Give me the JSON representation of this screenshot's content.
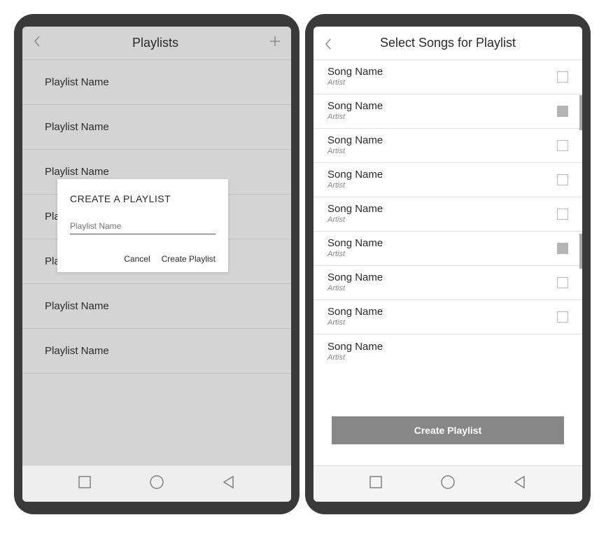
{
  "phone1": {
    "title": "Playlists",
    "playlists": [
      {
        "name": "Playlist Name"
      },
      {
        "name": "Playlist Name"
      },
      {
        "name": "Playlist Name"
      },
      {
        "name": "Playlist Name"
      },
      {
        "name": "Playlist Name"
      },
      {
        "name": "Playlist Name"
      },
      {
        "name": "Playlist Name"
      }
    ],
    "modal": {
      "title": "CREATE A  PLAYLIST",
      "placeholder": "Playlist Name",
      "cancel": "Cancel",
      "create": "Create Playlist"
    }
  },
  "phone2": {
    "title": "Select Songs for Playlist",
    "songs": [
      {
        "name": "Song Name",
        "artist": "Artist",
        "checked": false
      },
      {
        "name": "Song Name",
        "artist": "Artist",
        "checked": true
      },
      {
        "name": "Song Name",
        "artist": "Artist",
        "checked": false
      },
      {
        "name": "Song Name",
        "artist": "Artist",
        "checked": false
      },
      {
        "name": "Song Name",
        "artist": "Artist",
        "checked": false
      },
      {
        "name": "Song Name",
        "artist": "Artist",
        "checked": true
      },
      {
        "name": "Song Name",
        "artist": "Artist",
        "checked": false
      },
      {
        "name": "Song Name",
        "artist": "Artist",
        "checked": false
      },
      {
        "name": "Song Name",
        "artist": "Artist",
        "checked": false
      }
    ],
    "createBtn": "Create Playlist"
  }
}
